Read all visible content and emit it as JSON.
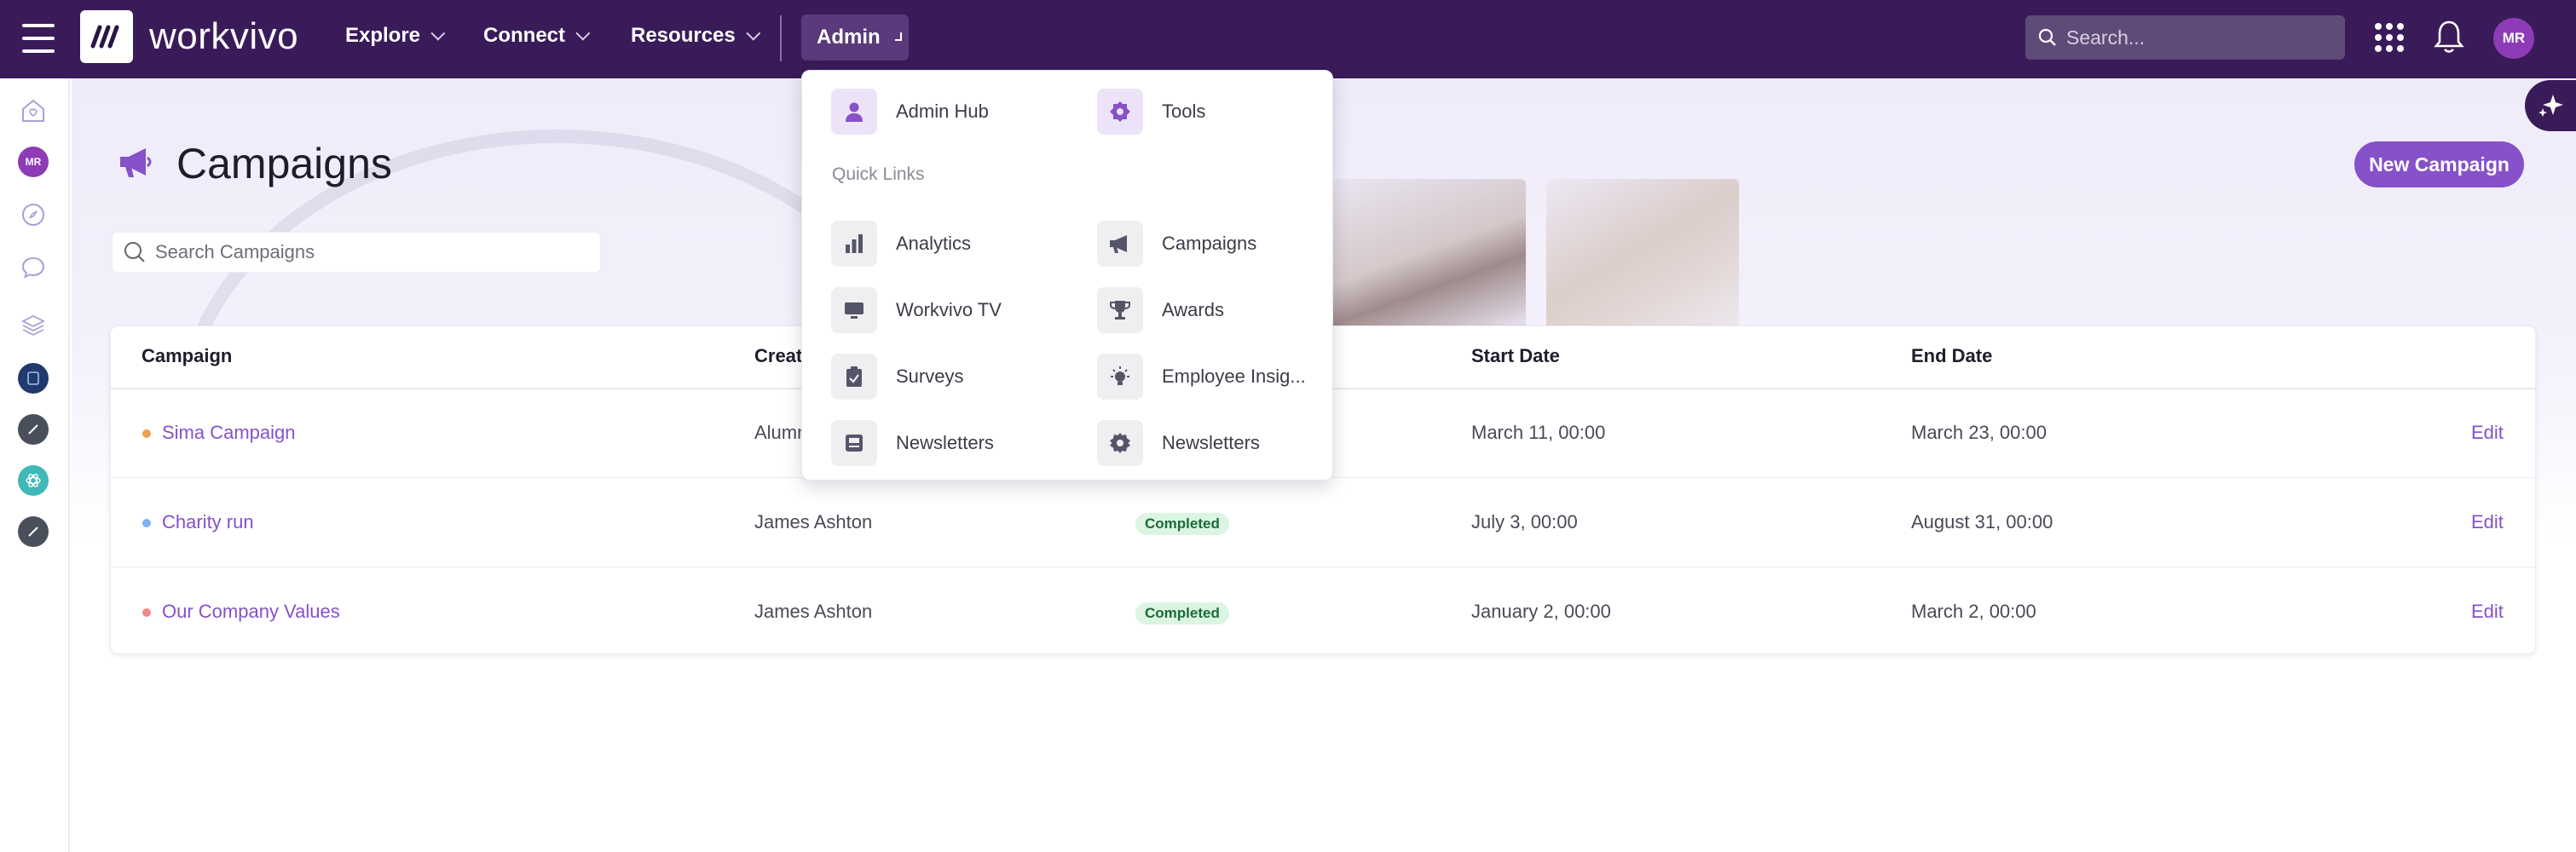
{
  "topbar": {
    "brand": "workvivo",
    "nav": [
      {
        "label": "Explore"
      },
      {
        "label": "Connect"
      },
      {
        "label": "Resources"
      }
    ],
    "admin_label": "Admin",
    "search_placeholder": "Search...",
    "user_initials": "MR"
  },
  "rail": {
    "user_initials": "MR"
  },
  "page": {
    "title": "Campaigns",
    "new_button": "New Campaign",
    "search_placeholder": "Search Campaigns"
  },
  "table": {
    "headers": {
      "campaign": "Campaign",
      "created": "Creat",
      "start": "Start Date",
      "end": "End Date"
    },
    "rows": [
      {
        "name": "Sima Campaign",
        "creator": "Alumn",
        "status": "",
        "start": "March 11, 00:00",
        "end": "March 23, 00:00",
        "edit": "Edit",
        "dot_color": "#f0a04b"
      },
      {
        "name": "Charity run",
        "creator": "James Ashton",
        "status": "Completed",
        "start": "July 3, 00:00",
        "end": "August 31, 00:00",
        "edit": "Edit",
        "dot_color": "#7fb0f5"
      },
      {
        "name": "Our Company Values",
        "creator": "James Ashton",
        "status": "Completed",
        "start": "January 2, 00:00",
        "end": "March 2, 00:00",
        "edit": "Edit",
        "dot_color": "#f08a8a"
      }
    ]
  },
  "admin_menu": {
    "top": [
      {
        "label": "Admin Hub",
        "icon": "person-icon"
      },
      {
        "label": "Tools",
        "icon": "gear-badge-icon"
      }
    ],
    "quick_links_heading": "Quick Links",
    "links": [
      {
        "label": "Analytics",
        "icon": "bar-chart-icon"
      },
      {
        "label": "Campaigns",
        "icon": "megaphone-icon"
      },
      {
        "label": "Workvivo TV",
        "icon": "tv-icon"
      },
      {
        "label": "Awards",
        "icon": "trophy-icon"
      },
      {
        "label": "Surveys",
        "icon": "clipboard-icon"
      },
      {
        "label": "Employee Insig...",
        "icon": "lightbulb-icon"
      },
      {
        "label": "Newsletters",
        "icon": "newsletter-icon"
      },
      {
        "label": "Newsletters",
        "icon": "gear-icon"
      }
    ]
  },
  "colors": {
    "topbar": "#3a1b59",
    "accent": "#8651c9",
    "badge_bg": "#dcf5e3",
    "badge_text": "#1c6b36"
  }
}
